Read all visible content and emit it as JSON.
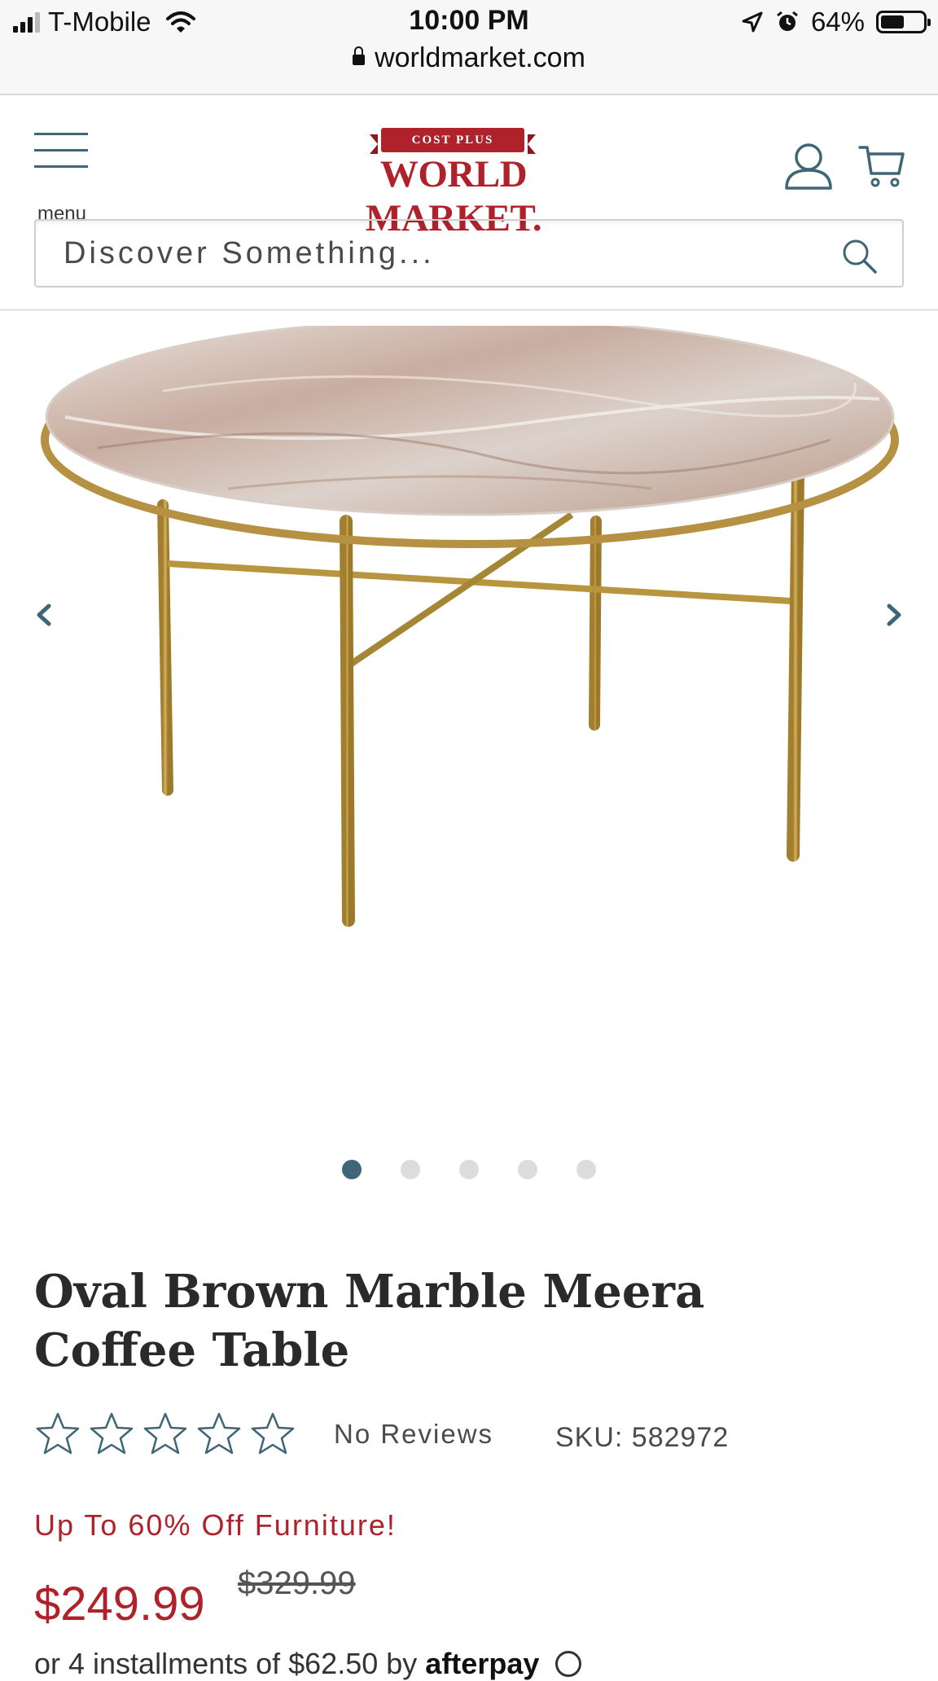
{
  "status_bar": {
    "carrier": "T-Mobile",
    "time": "10:00 PM",
    "battery_percent_label": "64%",
    "battery_level": 0.64,
    "url": "worldmarket.com"
  },
  "header": {
    "menu_label": "menu",
    "logo_ribbon": "COST PLUS",
    "logo_text": "WORLD MARKET.",
    "search_placeholder": "Discover Something..."
  },
  "gallery": {
    "slide_count": 5,
    "active_slide": 1,
    "image_icon": "marble-coffee-table-photo"
  },
  "product": {
    "title": "Oval Brown Marble Meera Coffee Table",
    "rating": 0,
    "max_rating": 5,
    "reviews_label": "No Reviews",
    "sku_label": "SKU: 582972",
    "promo": "Up To 60% Off Furniture!",
    "price": "$249.99",
    "original_price": "$329.99",
    "installments_text": "or 4 installments of $62.50 by",
    "installments_provider": "afterpay"
  },
  "colors": {
    "brand_red": "#b0222b",
    "accent_teal": "#3f6676",
    "dot_inactive": "#dcdcdc"
  }
}
